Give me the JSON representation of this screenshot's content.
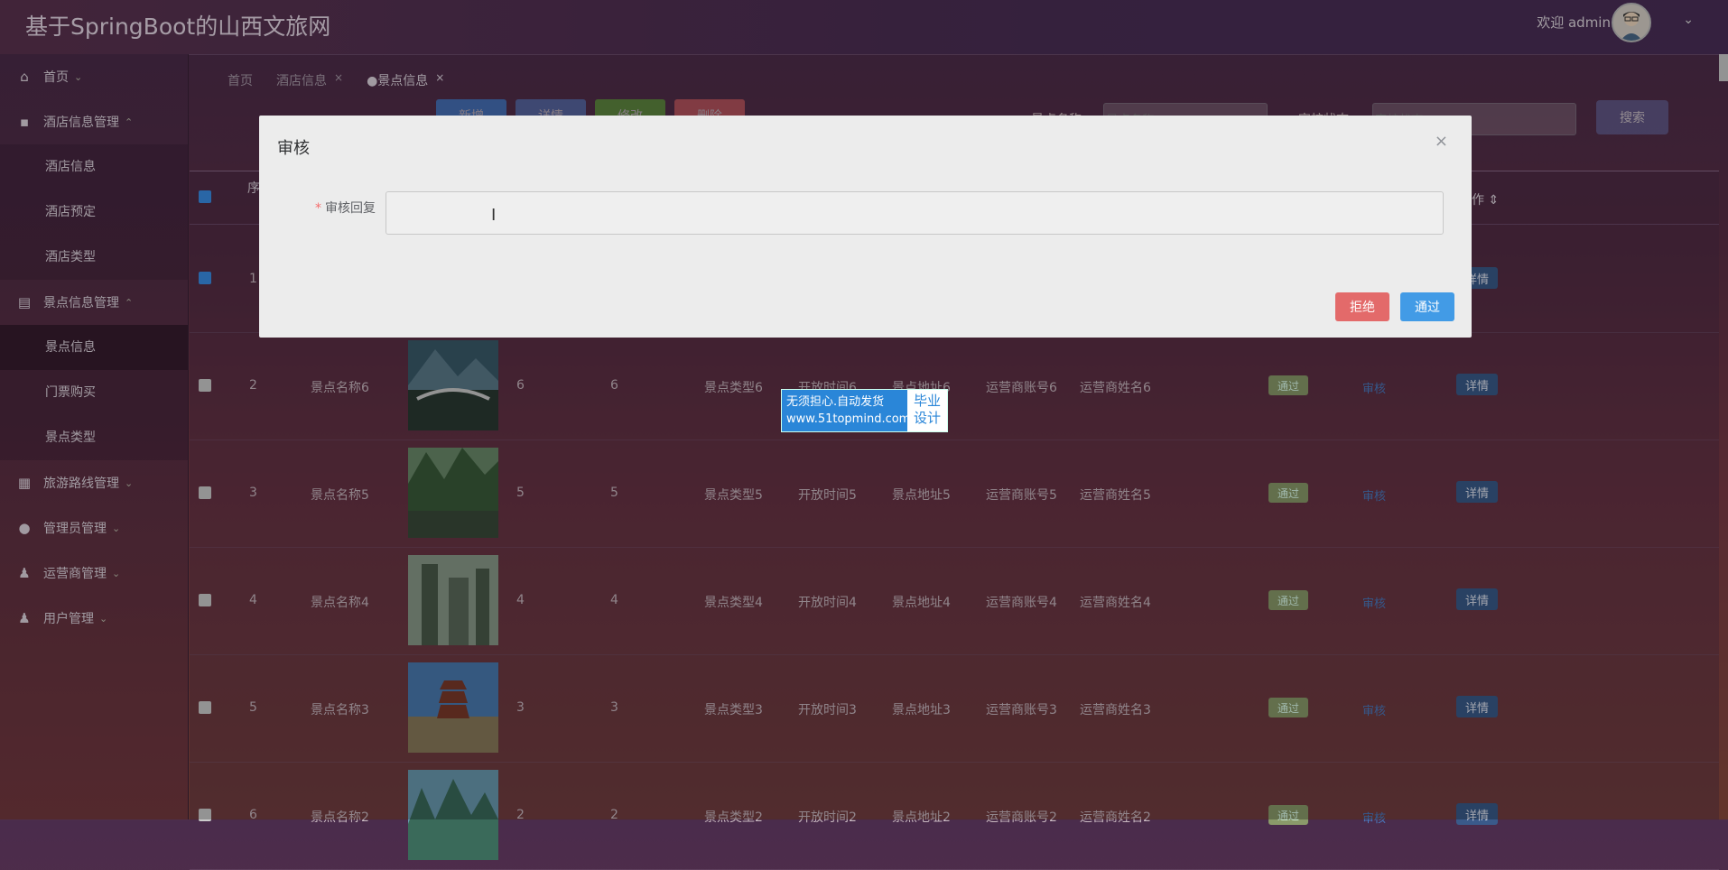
{
  "header": {
    "title": "基于SpringBoot的山西文旅网",
    "welcome": "欢迎 admin",
    "avatar": "avatar",
    "chevron": "chevron-down-icon"
  },
  "sidebar": {
    "items": [
      {
        "label": "首页",
        "icon": "home-icon",
        "chevron": "⌄"
      },
      {
        "label": "酒店信息管理",
        "icon": "hotel-icon",
        "chevron": "⌃",
        "children": [
          "酒店信息",
          "酒店预定",
          "酒店类型"
        ]
      },
      {
        "label": "景点信息管理",
        "icon": "scenic-icon",
        "chevron": "⌃",
        "children": [
          "景点信息",
          "门票购买",
          "景点类型"
        ]
      },
      {
        "label": "旅游路线管理",
        "icon": "route-icon",
        "chevron": "⌄"
      },
      {
        "label": "管理员管理",
        "icon": "admin-icon",
        "chevron": "⌄"
      },
      {
        "label": "运营商管理",
        "icon": "operator-icon",
        "chevron": "⌄"
      },
      {
        "label": "用户管理",
        "icon": "user-icon",
        "chevron": "⌄"
      }
    ]
  },
  "breadcrumb": [
    "首页",
    "酒店信息",
    "●景点信息"
  ],
  "toolbar": {
    "buttons": [
      {
        "label": "新增",
        "color": "#409eff"
      },
      {
        "label": "详情",
        "color": "#5a8ad8"
      },
      {
        "label": "修改",
        "color": "#67c23a"
      },
      {
        "label": "删除",
        "color": "#f56c6c"
      }
    ]
  },
  "search": {
    "name_label": "景点名称:",
    "name_placeholder": "景点名称",
    "status_label": "审核状态:",
    "status_placeholder": "审核状态",
    "button": "搜索"
  },
  "table": {
    "seq_header": "序",
    "ops_header": "作",
    "rows": [
      {
        "seq": "1",
        "checked": true
      },
      {
        "seq": "2",
        "name": "景点名称6",
        "num1": "6",
        "num2": "6",
        "type": "景点类型6",
        "time": "开放时间6",
        "addr": "景点地址6",
        "account": "运营商账号6",
        "opname": "运营商姓名6",
        "status": "通过",
        "audit": "审核",
        "detail": "详情"
      },
      {
        "seq": "3",
        "name": "景点名称5",
        "num1": "5",
        "num2": "5",
        "type": "景点类型5",
        "time": "开放时间5",
        "addr": "景点地址5",
        "account": "运营商账号5",
        "opname": "运营商姓名5",
        "status": "通过",
        "audit": "审核",
        "detail": "详情"
      },
      {
        "seq": "4",
        "name": "景点名称4",
        "num1": "4",
        "num2": "4",
        "type": "景点类型4",
        "time": "开放时间4",
        "addr": "景点地址4",
        "account": "运营商账号4",
        "opname": "运营商姓名4",
        "status": "通过",
        "audit": "审核",
        "detail": "详情"
      },
      {
        "seq": "5",
        "name": "景点名称3",
        "num1": "3",
        "num2": "3",
        "type": "景点类型3",
        "time": "开放时间3",
        "addr": "景点地址3",
        "account": "运营商账号3",
        "opname": "运营商姓名3",
        "status": "通过",
        "audit": "审核",
        "detail": "详情"
      },
      {
        "seq": "6",
        "name": "景点名称2",
        "num1": "2",
        "num2": "2",
        "type": "景点类型2",
        "time": "开放时间2",
        "addr": "景点地址2",
        "account": "运营商账号2",
        "opname": "运营商姓名2",
        "status": "通过",
        "audit": "审核",
        "detail": "详情"
      }
    ],
    "row1_detail": "详情"
  },
  "watermark": {
    "line1": "无须担心.自动发货",
    "line2": "www.51topmind.com",
    "right1": "毕业",
    "right2": "设计"
  },
  "modal": {
    "title": "审核",
    "close": "×",
    "field_label": "审核回复",
    "required_mark": "*",
    "value": "",
    "reject": "拒绝",
    "pass": "通过"
  }
}
